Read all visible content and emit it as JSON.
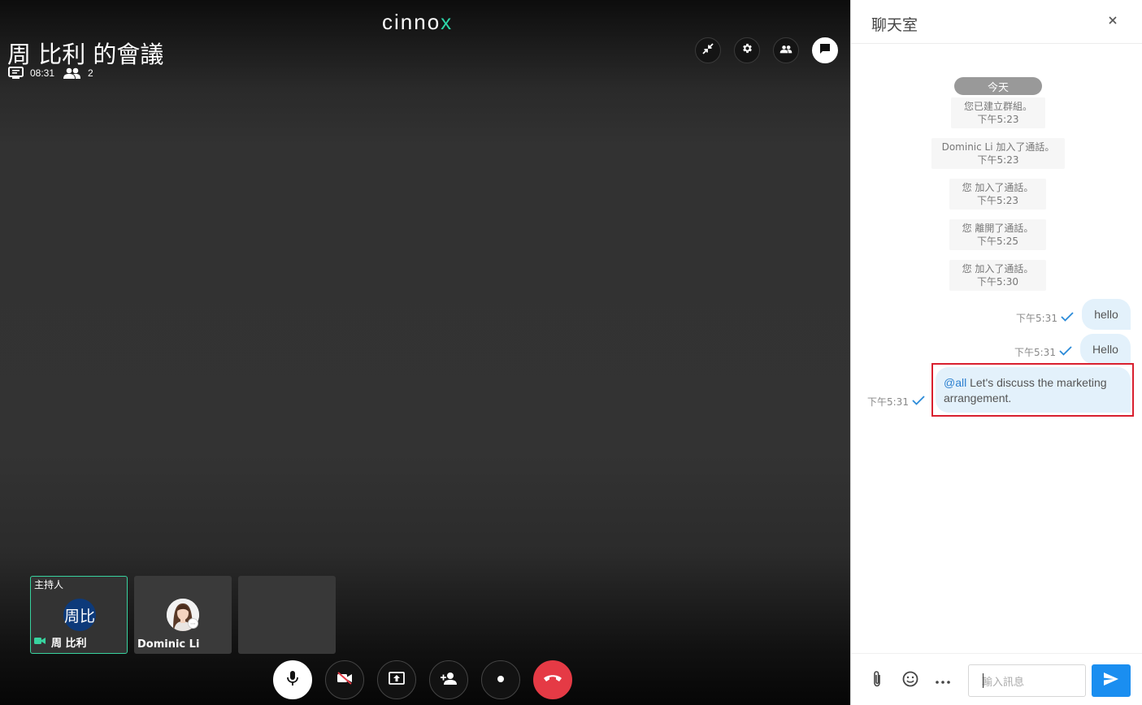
{
  "logo": {
    "text_main": "cinno",
    "text_accent": "x"
  },
  "meeting": {
    "title": "周 比利 的會議",
    "duration": "08:31",
    "participant_count": "2"
  },
  "participants": [
    {
      "role": "主持人",
      "initials": "周比",
      "name": "周 比利"
    },
    {
      "role": "",
      "name": "Dominic Li"
    }
  ],
  "chat": {
    "title": "聊天室",
    "day_label": "今天",
    "system_messages": [
      {
        "text": "您已建立群組。",
        "time": "下午5:23"
      },
      {
        "text": "Dominic Li 加入了通話。",
        "time": "下午5:23"
      },
      {
        "text": "您 加入了通話。",
        "time": "下午5:23"
      },
      {
        "text": "您 離開了通話。",
        "time": "下午5:25"
      },
      {
        "text": "您 加入了通話。",
        "time": "下午5:30"
      }
    ],
    "messages": [
      {
        "text": "hello",
        "time": "下午5:31"
      },
      {
        "text": "Hello",
        "time": "下午5:31"
      },
      {
        "mention": "@all",
        "text": " Let's discuss the marketing arrangement.",
        "time": "下午5:31"
      }
    ],
    "input_placeholder": "輸入訊息"
  },
  "colors": {
    "accent": "#2dd4a8",
    "hangup": "#e53a45",
    "send": "#1a8ef0",
    "highlight": "#d9202f",
    "bubble": "#e3f1fb"
  }
}
